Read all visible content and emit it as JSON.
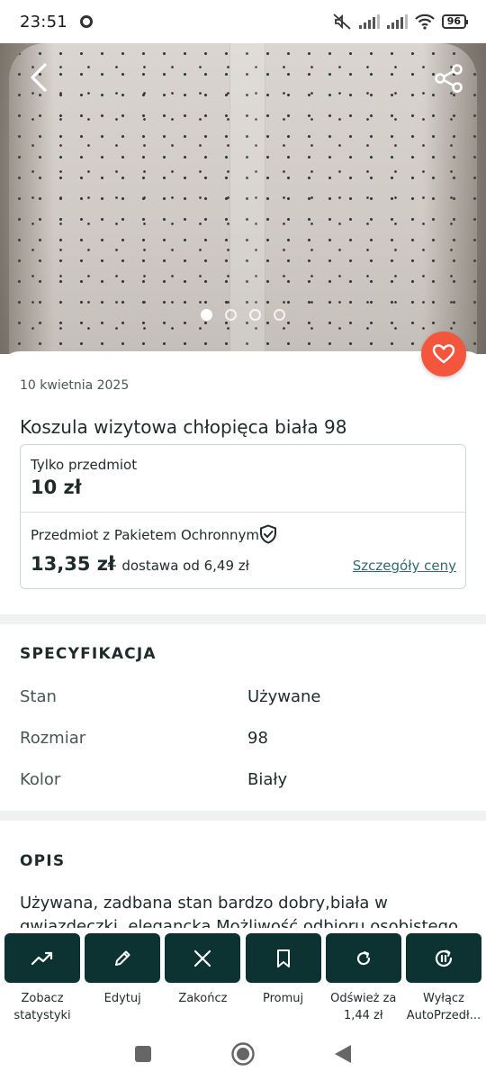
{
  "status_bar": {
    "time": "23:51",
    "battery": "96"
  },
  "listing": {
    "date": "10 kwietnia 2025",
    "title": "Koszula wizytowa chłopięca biała 98",
    "price_only_label": "Tylko przedmiot",
    "price_only": "10 zł",
    "protection_label": "Przedmiot z Pakietem Ochronnym",
    "price_total": "13,35 zł",
    "shipping": "+ dostawa od 6,49 zł",
    "price_details_link": "Szczegóły ceny"
  },
  "gallery": {
    "total_images": 4,
    "active_index": 0
  },
  "spec": {
    "title": "SPECYFIKACJA",
    "rows": [
      {
        "key": "Stan",
        "value": "Używane"
      },
      {
        "key": "Rozmiar",
        "value": "98"
      },
      {
        "key": "Kolor",
        "value": "Biały"
      }
    ]
  },
  "description": {
    "title": "OPIS",
    "text": "Używana, zadbana stan bardzo dobry,biała w gwiazdeczki, elegancka Możliwość odbioru osobistego Dobre Miasto"
  },
  "actions": [
    {
      "label": "Zobacz statystyki",
      "icon": "trending-up-icon"
    },
    {
      "label": "Edytuj",
      "icon": "pencil-icon"
    },
    {
      "label": "Zakończ",
      "icon": "close-icon"
    },
    {
      "label": "Promuj",
      "icon": "bookmark-icon"
    },
    {
      "label": "Odśwież za 1,44 zł",
      "icon": "refresh-icon"
    },
    {
      "label": "Wyłącz AutoPrzedł...",
      "icon": "pause-refresh-icon"
    }
  ],
  "colors": {
    "accent": "#0c3232",
    "favorite": "#f4563d",
    "link": "#2f6a6e",
    "divider": "#f0f2f2"
  }
}
